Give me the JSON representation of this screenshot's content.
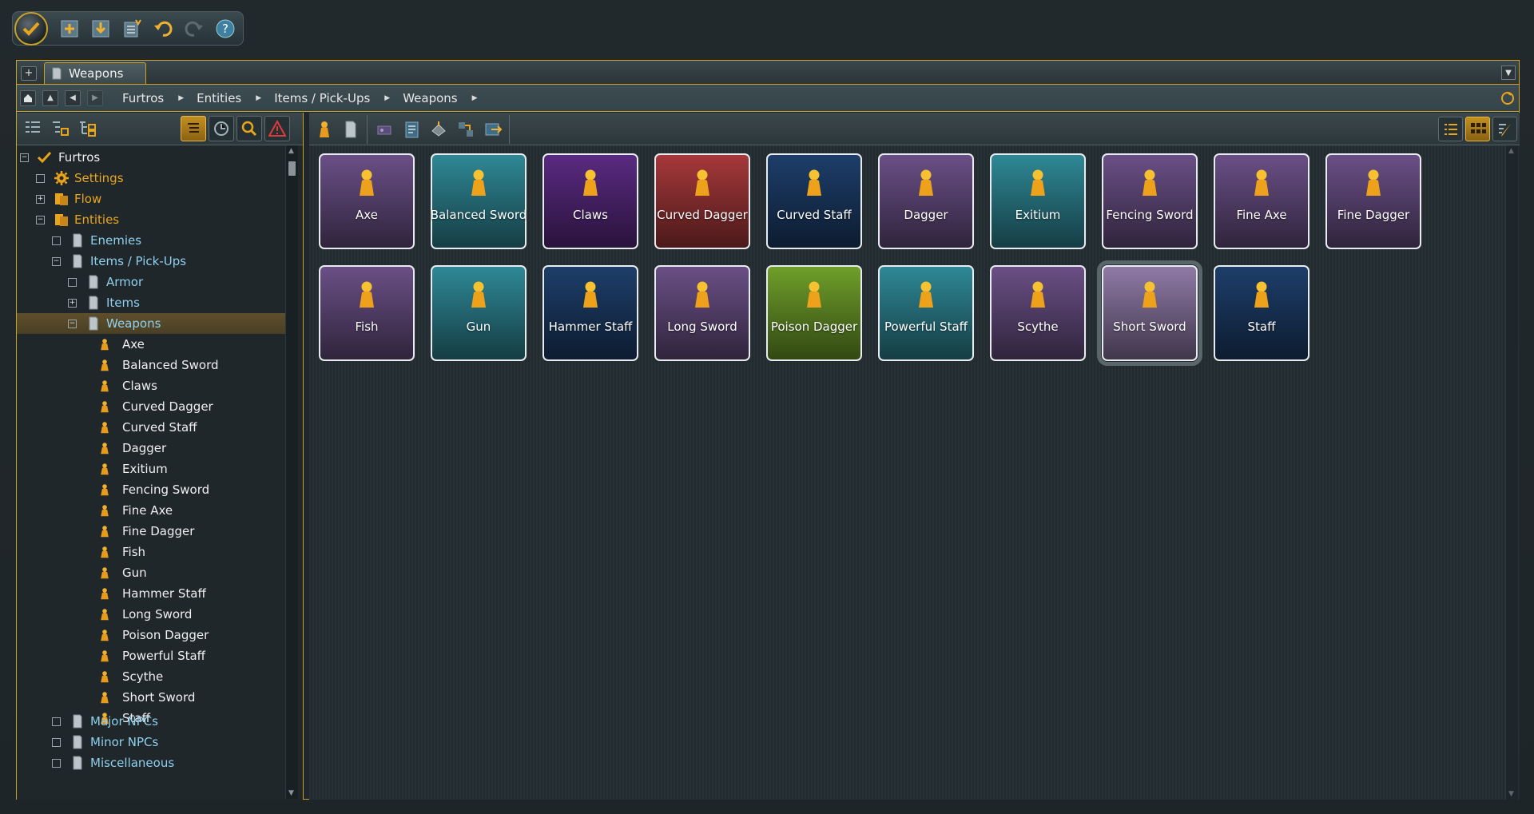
{
  "app": {
    "toolbar": {
      "buttons": [
        "logo",
        "new",
        "save",
        "generate",
        "undo",
        "redo",
        "help"
      ]
    },
    "tab": {
      "label": "Weapons",
      "add_label": "+"
    },
    "breadcrumb": {
      "items": [
        "Furtros",
        "Entities",
        "Items / Pick-Ups",
        "Weapons"
      ]
    }
  },
  "tree": {
    "root": "Furtros",
    "settings": "Settings",
    "flow": "Flow",
    "entities": "Entities",
    "enemies": "Enemies",
    "items_pickups": "Items / Pick-Ups",
    "armor": "Armor",
    "items": "Items",
    "weapons": "Weapons",
    "weapon_items": [
      "Axe",
      "Balanced Sword",
      "Claws",
      "Curved Dagger",
      "Curved Staff",
      "Dagger",
      "Exitium",
      "Fencing Sword",
      "Fine Axe",
      "Fine Dagger",
      "Fish",
      "Gun",
      "Hammer Staff",
      "Long Sword",
      "Poison Dagger",
      "Powerful Staff",
      "Scythe",
      "Short Sword",
      "Staff"
    ],
    "major_npcs": "Major NPCs",
    "minor_npcs": "Minor NPCs",
    "misc": "Miscellaneous"
  },
  "tiles": [
    {
      "label": "Axe",
      "color": "#6a4f86"
    },
    {
      "label": "Balanced Sword",
      "color": "#2f8896"
    },
    {
      "label": "Claws",
      "color": "#5a2a82"
    },
    {
      "label": "Curved Dagger",
      "color": "#a6383a"
    },
    {
      "label": "Curved Staff",
      "color": "#1d3e6a"
    },
    {
      "label": "Dagger",
      "color": "#6a4f86"
    },
    {
      "label": "Exitium",
      "color": "#2f8896"
    },
    {
      "label": "Fencing Sword",
      "color": "#6a4f86"
    },
    {
      "label": "Fine Axe",
      "color": "#6a4f86"
    },
    {
      "label": "Fine Dagger",
      "color": "#6a4f86"
    },
    {
      "label": "Fish",
      "color": "#6a4f86"
    },
    {
      "label": "Gun",
      "color": "#2f8896"
    },
    {
      "label": "Hammer Staff",
      "color": "#1d3e6a"
    },
    {
      "label": "Long Sword",
      "color": "#6a4f86"
    },
    {
      "label": "Poison Dagger",
      "color": "#6f9f2a"
    },
    {
      "label": "Powerful Staff",
      "color": "#2f8896"
    },
    {
      "label": "Scythe",
      "color": "#6a4f86"
    },
    {
      "label": "Short Sword",
      "color": "#8f7aa6"
    },
    {
      "label": "Staff",
      "color": "#1d3e6a"
    }
  ],
  "colors": {
    "accent": "#c9a227",
    "orange_label": "#e8a51c",
    "blue_label": "#8fd0ee"
  }
}
